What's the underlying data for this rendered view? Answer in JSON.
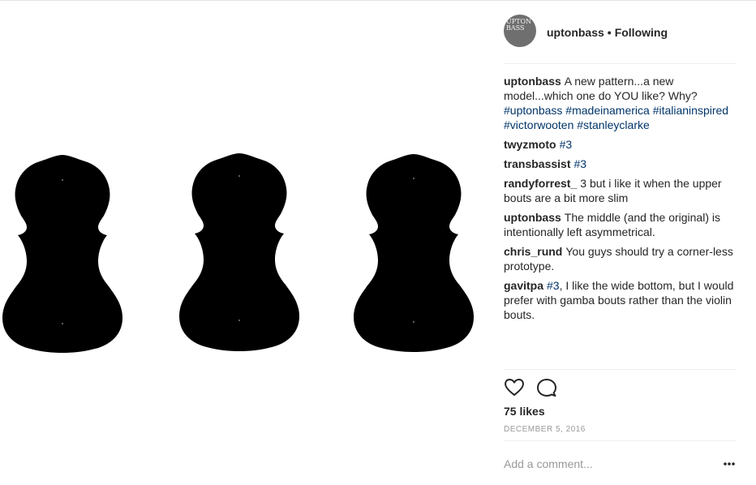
{
  "post": {
    "author": "uptonbass",
    "separator": "•",
    "follow_state": "Following",
    "avatar_text": "UPTON BASS"
  },
  "comments": [
    {
      "user": "uptonbass",
      "parts": [
        {
          "t": "A new pattern...a new model...which one do YOU like? Why? "
        },
        {
          "t": "#uptonbass",
          "tag": true
        },
        {
          "t": " "
        },
        {
          "t": "#madeinamerica",
          "tag": true
        },
        {
          "t": " "
        },
        {
          "t": "#italianinspired",
          "tag": true
        },
        {
          "t": " "
        },
        {
          "t": "#victorwooten",
          "tag": true
        },
        {
          "t": " "
        },
        {
          "t": "#stanleyclarke",
          "tag": true
        }
      ]
    },
    {
      "user": "twyzmoto",
      "parts": [
        {
          "t": "#3",
          "tag": true
        }
      ]
    },
    {
      "user": "transbassist",
      "parts": [
        {
          "t": "#3",
          "tag": true
        }
      ]
    },
    {
      "user": "randyforrest_",
      "parts": [
        {
          "t": "3 but i like it when the upper bouts are a bit more slim"
        }
      ]
    },
    {
      "user": "uptonbass",
      "parts": [
        {
          "t": "The middle (and the original) is intentionally left asymmetrical."
        }
      ]
    },
    {
      "user": "chris_rund",
      "parts": [
        {
          "t": "You guys should try a corner-less prototype."
        }
      ]
    },
    {
      "user": "gavitpa",
      "parts": [
        {
          "t": "#3",
          "tag": true
        },
        {
          "t": ", I like the wide bottom, but I would prefer with gamba bouts rather than the violin bouts."
        }
      ]
    }
  ],
  "engagement": {
    "likes": "75 likes",
    "date": "DECEMBER 5, 2016"
  },
  "comment_input": {
    "placeholder": "Add a comment..."
  },
  "icons": {
    "like": "heart-icon",
    "comment": "speech-bubble-icon",
    "more": "ellipsis-icon"
  },
  "colors": {
    "text": "#262626",
    "hashtag": "#003569",
    "muted": "#999999",
    "silhouette": "#000000"
  }
}
